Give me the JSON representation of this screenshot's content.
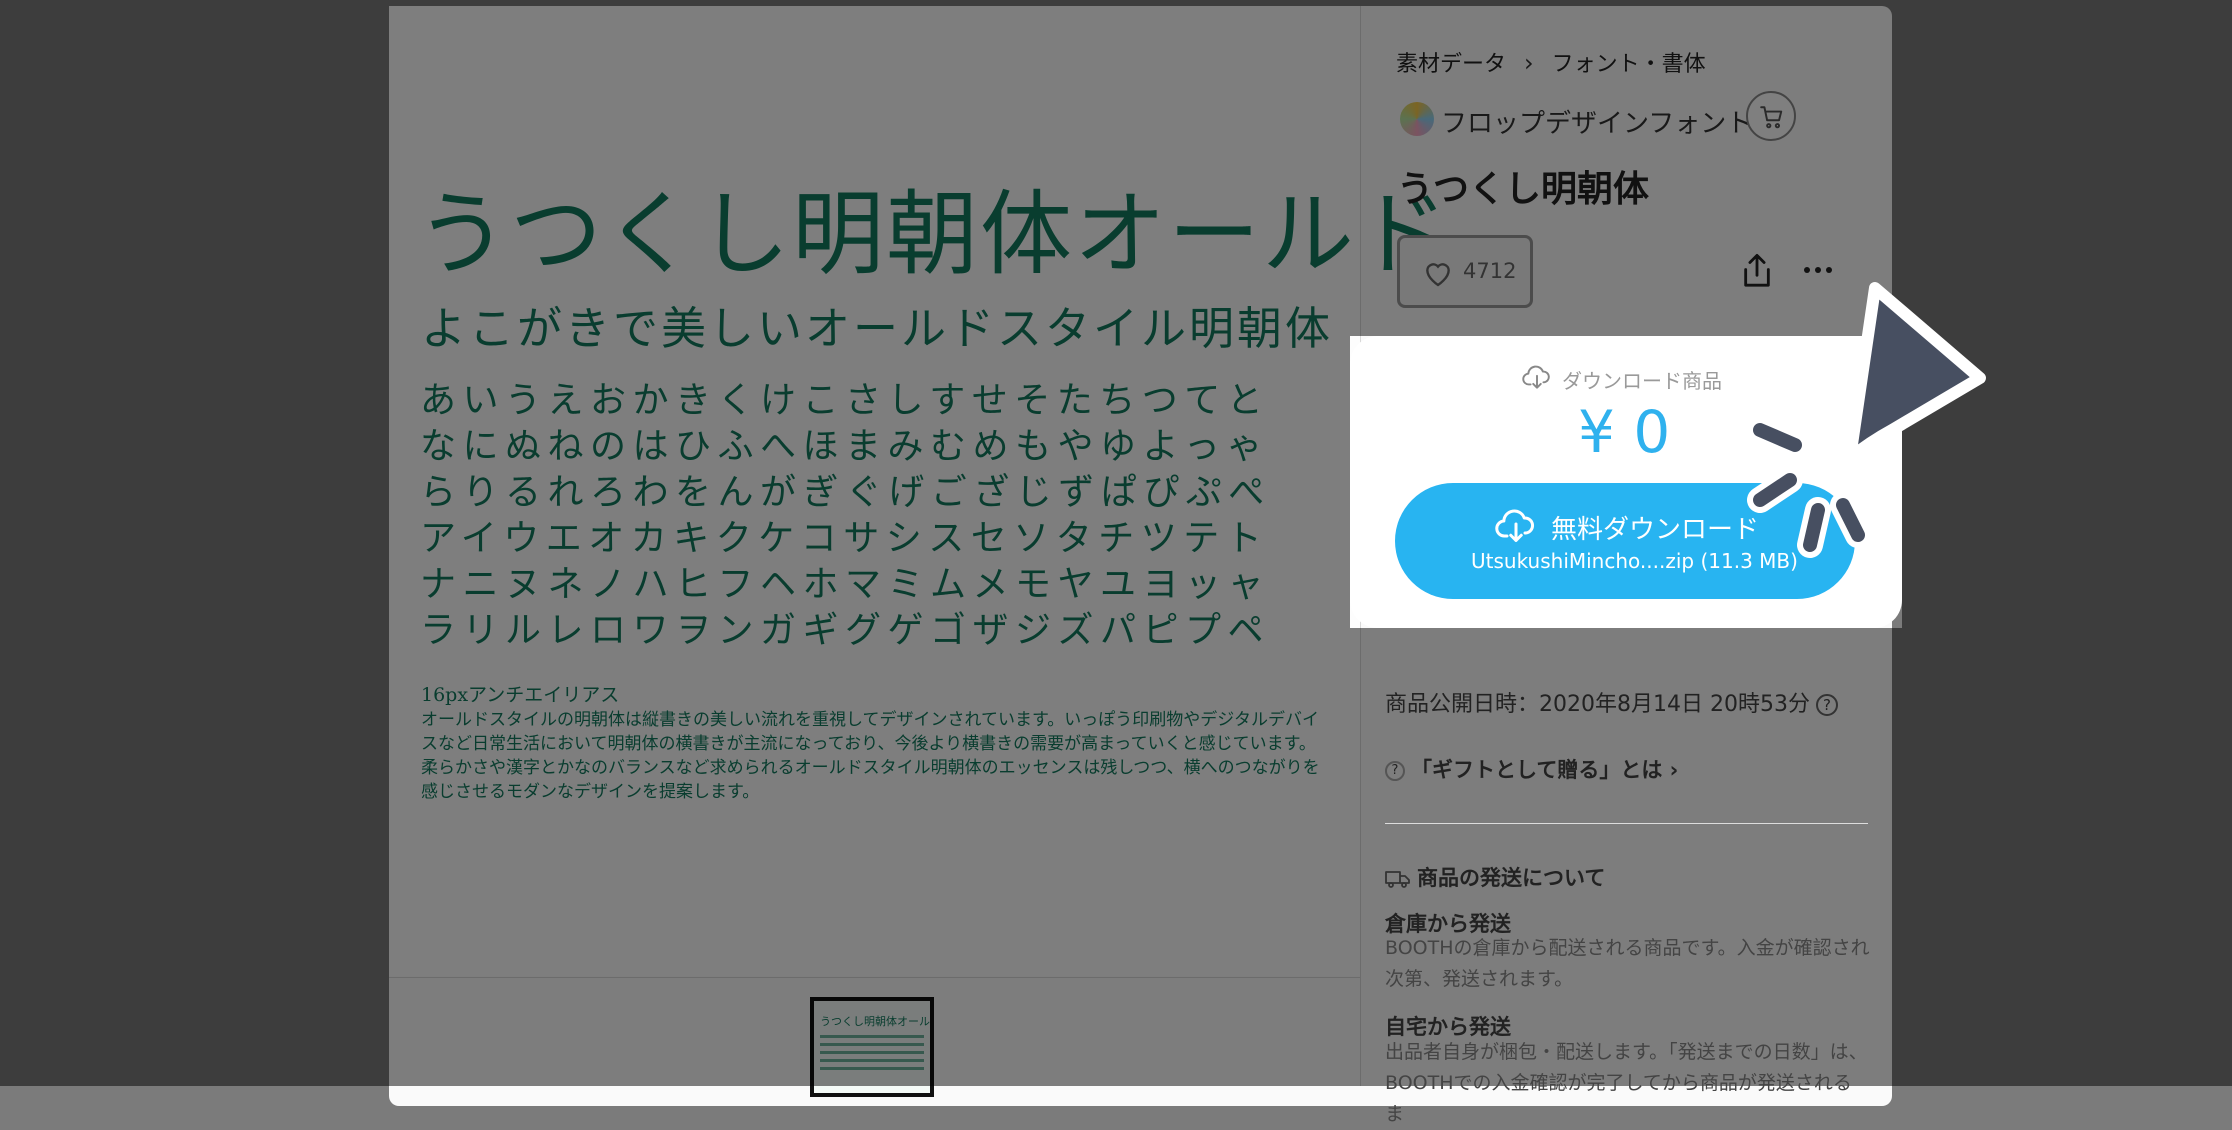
{
  "breadcrumb": {
    "category": "素材データ",
    "subcategory": "フォント・書体"
  },
  "shop": {
    "name": "フロップデザインフォント"
  },
  "item": {
    "title": "うつくし明朝体",
    "likes": "4712"
  },
  "download": {
    "type_label": "ダウンロード商品",
    "price": "¥ 0",
    "button_label": "無料ダウンロード",
    "file": "UtsukushiMincho....zip (11.3 MB)"
  },
  "preview": {
    "title": "うつくし明朝体オールド",
    "subtitle": "よこがきで美しいオールドスタイル明朝体",
    "kana_lines": [
      "あいうえおかきくけこさしすせそたちつてと",
      "なにぬねのはひふへほまみむめもやゆよっゃ",
      "らりるれろわをんがぎぐげござじずぱぴぷぺ",
      "アイウエオカキクケコサシスセソタチツテト",
      "ナニヌネノハヒフヘホマミムメモヤユヨッャ",
      "ラリルレロワヲンガギグゲゴザジズパピプペ"
    ],
    "small_label": "16pxアンチエイリアス",
    "paragraph": "オールドスタイルの明朝体は縦書きの美しい流れを重視してデザインされています。いっぽう印刷物やデジタルデバイスなど日常生活において明朝体の横書きが主流になっており、今後より横書きの需要が高まっていくと感じています。柔らかさや漢字とかなのバランスなど求められるオールドスタイル明朝体のエッセンスは残しつつ、横へのつながりを感じさせるモダンなデザインを提案します。",
    "thumb_title": "うつくし明朝体オールド"
  },
  "info": {
    "publish": "商品公開日時：2020年8月14日 20時53分",
    "gift": "「ギフトとして贈る」とは ›"
  },
  "shipping": {
    "title": "商品の発送について",
    "warehouse_title": "倉庫から発送",
    "warehouse_text": "BOOTHの倉庫から配送される商品です。入金が確認され次第、発送されます。",
    "home_title": "自宅から発送",
    "home_text": "出品者自身が梱包・配送します。「発送までの日数」は、BOOTHでの入金確認が完了してから商品が発送されるま"
  },
  "colors": {
    "accent": "#28b4f1",
    "price": "#2fb1ee",
    "font_sample": "#127a5e",
    "cursor": "#474f61"
  },
  "icons": [
    "cart-icon",
    "heart-icon",
    "share-icon",
    "more-icon",
    "cloud-download-icon",
    "help-icon",
    "truck-icon",
    "pointer-cursor-icon"
  ]
}
